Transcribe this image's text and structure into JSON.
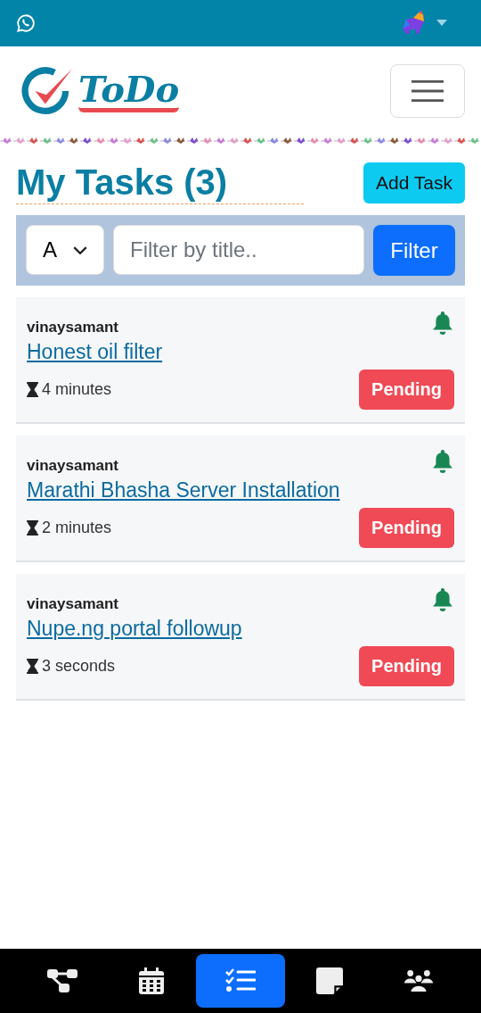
{
  "logo": {
    "text": "ToDo"
  },
  "page_title": "My Tasks (3)",
  "add_button": "Add Task",
  "filter": {
    "select_value": "A",
    "placeholder": "Filter by title..",
    "button": "Filter"
  },
  "tasks": [
    {
      "user": "vinaysamant",
      "title": "Honest oil filter",
      "age": "4 minutes",
      "status": "Pending"
    },
    {
      "user": "vinaysamant",
      "title": "Marathi Bhasha Server Installation",
      "age": "2 minutes",
      "status": "Pending"
    },
    {
      "user": "vinaysamant",
      "title": "Nupe.ng portal followup",
      "age": "3 seconds",
      "status": "Pending"
    }
  ],
  "bottom_nav": [
    {
      "kind": "workflow",
      "selected": false
    },
    {
      "kind": "calendar",
      "selected": false
    },
    {
      "kind": "tasks",
      "selected": true
    },
    {
      "kind": "note",
      "selected": false
    },
    {
      "kind": "team",
      "selected": false
    }
  ]
}
